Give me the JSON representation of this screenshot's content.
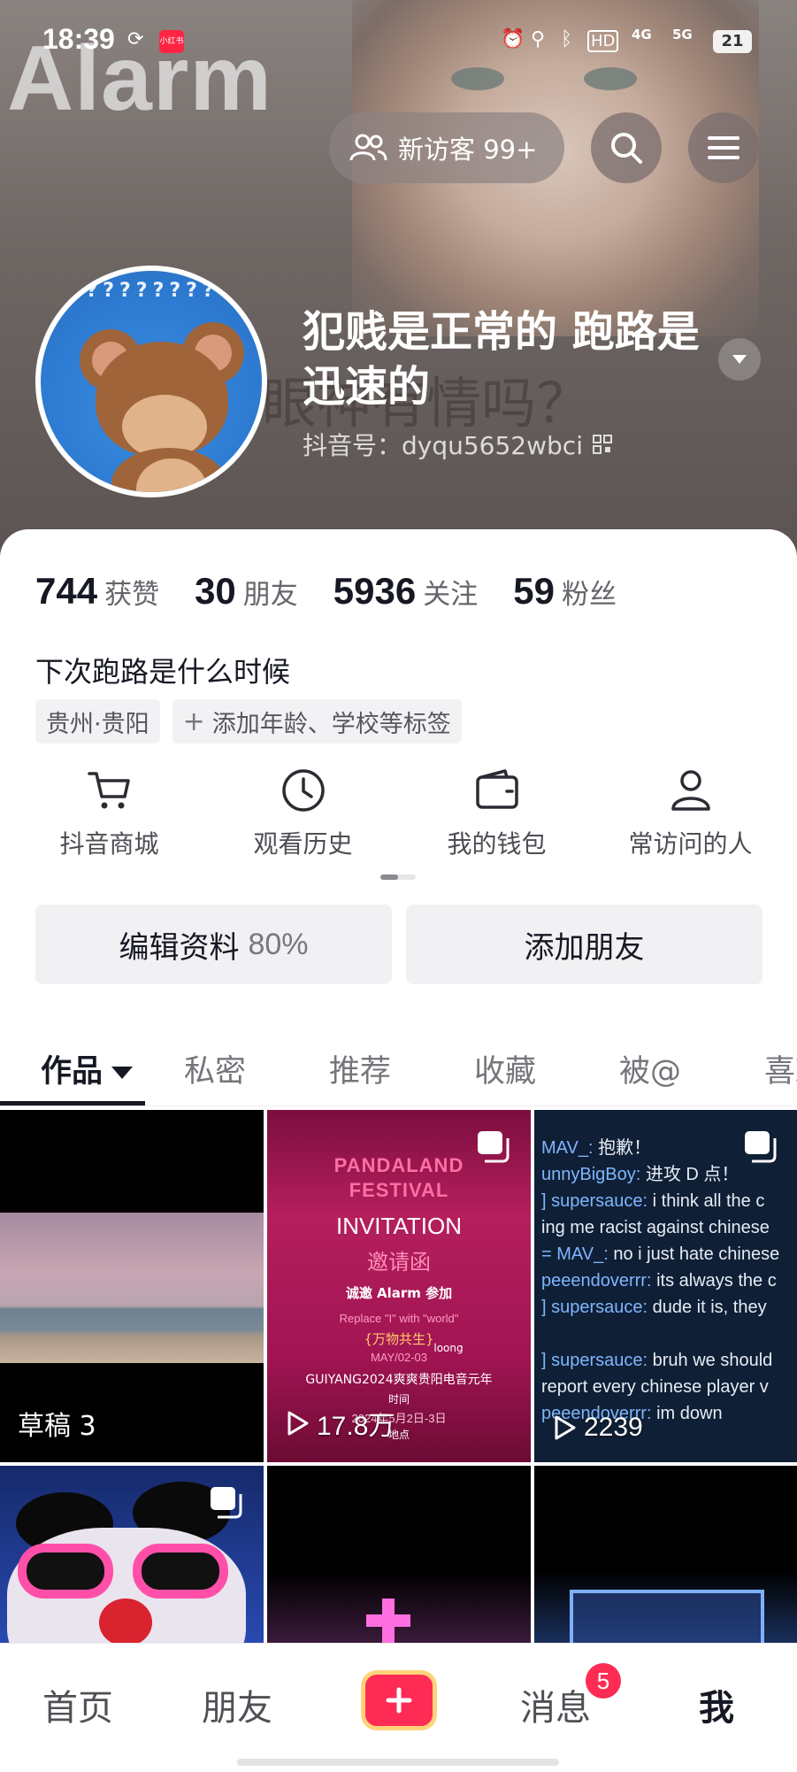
{
  "status_bar": {
    "time": "18:39",
    "app_badge": "小红书",
    "network_a": "4G",
    "network_b": "5G",
    "battery": "21"
  },
  "banner": {
    "overlay_word": "Alarm",
    "ghost_text": "眼神有情吗？"
  },
  "header_actions": {
    "visitor_label": "新访客 99+",
    "search_icon": "search-icon",
    "menu_icon": "menu-icon"
  },
  "profile": {
    "nickname": "犯贱是正常的 跑路是迅速的",
    "douyin_id": "抖音号：dyqu5652wbci",
    "bio": "下次跑路是什么时候"
  },
  "stats": [
    {
      "value": "744",
      "label": "获赞"
    },
    {
      "value": "30",
      "label": "朋友"
    },
    {
      "value": "5936",
      "label": "关注"
    },
    {
      "value": "59",
      "label": "粉丝"
    }
  ],
  "tags": {
    "location": "贵州·贵阳",
    "add_tag": "添加年龄、学校等标签"
  },
  "shortcuts": [
    {
      "label": "抖音商城",
      "icon": "cart-icon"
    },
    {
      "label": "观看历史",
      "icon": "clock-icon"
    },
    {
      "label": "我的钱包",
      "icon": "wallet-icon"
    },
    {
      "label": "常访问的人",
      "icon": "person-icon"
    }
  ],
  "actions": {
    "edit_profile": "编辑资料",
    "edit_progress": "80%",
    "add_friend": "添加朋友"
  },
  "tabs": [
    "作品",
    "私密",
    "推荐",
    "收藏",
    "被@",
    "喜欢"
  ],
  "grid": {
    "draft_label": "草稿 3",
    "video2_plays": "17.8万",
    "video3_plays": "2239",
    "poster": {
      "title1": "PANDALAND",
      "title2": "FESTIVAL",
      "invitation": "INVITATION",
      "invitation_cn": "邀请函",
      "invite_line": "诚邀 Alarm 参加",
      "replace_line": "Replace \"I\" with \"world\"",
      "slogan": "{万物共生}",
      "date": "MAY/02-03",
      "brand": "loong",
      "event": "GUIYANG2024爽爽贵阳电音元年",
      "time_label": "时间",
      "time_value": "2024年5月2日-3日",
      "place_label": "地点"
    },
    "chat": [
      {
        "who": "MAV_:",
        "msg": " 抱歉！"
      },
      {
        "who": "unnyBigBoy:",
        "msg": " 进攻 D 点！"
      },
      {
        "who": "] supersauce:",
        "msg": " i think all the c"
      },
      {
        "who": "",
        "msg": "ing me racist against chinese"
      },
      {
        "who": "= MAV_:",
        "msg": " no i just hate chinese"
      },
      {
        "who": "peeendoverrr:",
        "msg": " its always the c"
      },
      {
        "who": "] supersauce:",
        "msg": " dude it is, they"
      },
      {
        "who": "",
        "msg": ""
      },
      {
        "who": "] supersauce:",
        "msg": " bruh we should"
      },
      {
        "who": "",
        "msg": "report every chinese player v"
      },
      {
        "who": "peeendoverrr:",
        "msg": " im down"
      }
    ]
  },
  "bottom_nav": {
    "home": "首页",
    "friends": "朋友",
    "messages": "消息",
    "messages_badge": "5",
    "me": "我"
  },
  "colors": {
    "accent": "#fe2c55",
    "text_primary": "#161823",
    "text_secondary": "#65666c"
  }
}
